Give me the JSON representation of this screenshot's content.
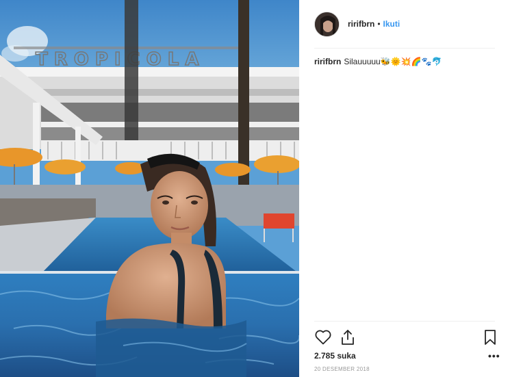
{
  "post": {
    "photo_sign": "TROPICOLA"
  },
  "header": {
    "username": "ririfbrn",
    "separator": "•",
    "follow_label": "Ikuti"
  },
  "caption": {
    "username": "ririfbrn",
    "text": "Silauuuuu",
    "emojis": "🐝🌞💥🌈🐾🐬"
  },
  "actions": {
    "like_icon": "heart-outline-icon",
    "share_icon": "share-upload-icon",
    "save_icon": "bookmark-icon",
    "more_icon": "ellipsis-icon",
    "more_label": "•••"
  },
  "stats": {
    "likes": "2.785 suka",
    "date": "20 DESEMBER 2018"
  },
  "colors": {
    "follow": "#3897f0",
    "text": "#262626",
    "muted": "#999999"
  }
}
